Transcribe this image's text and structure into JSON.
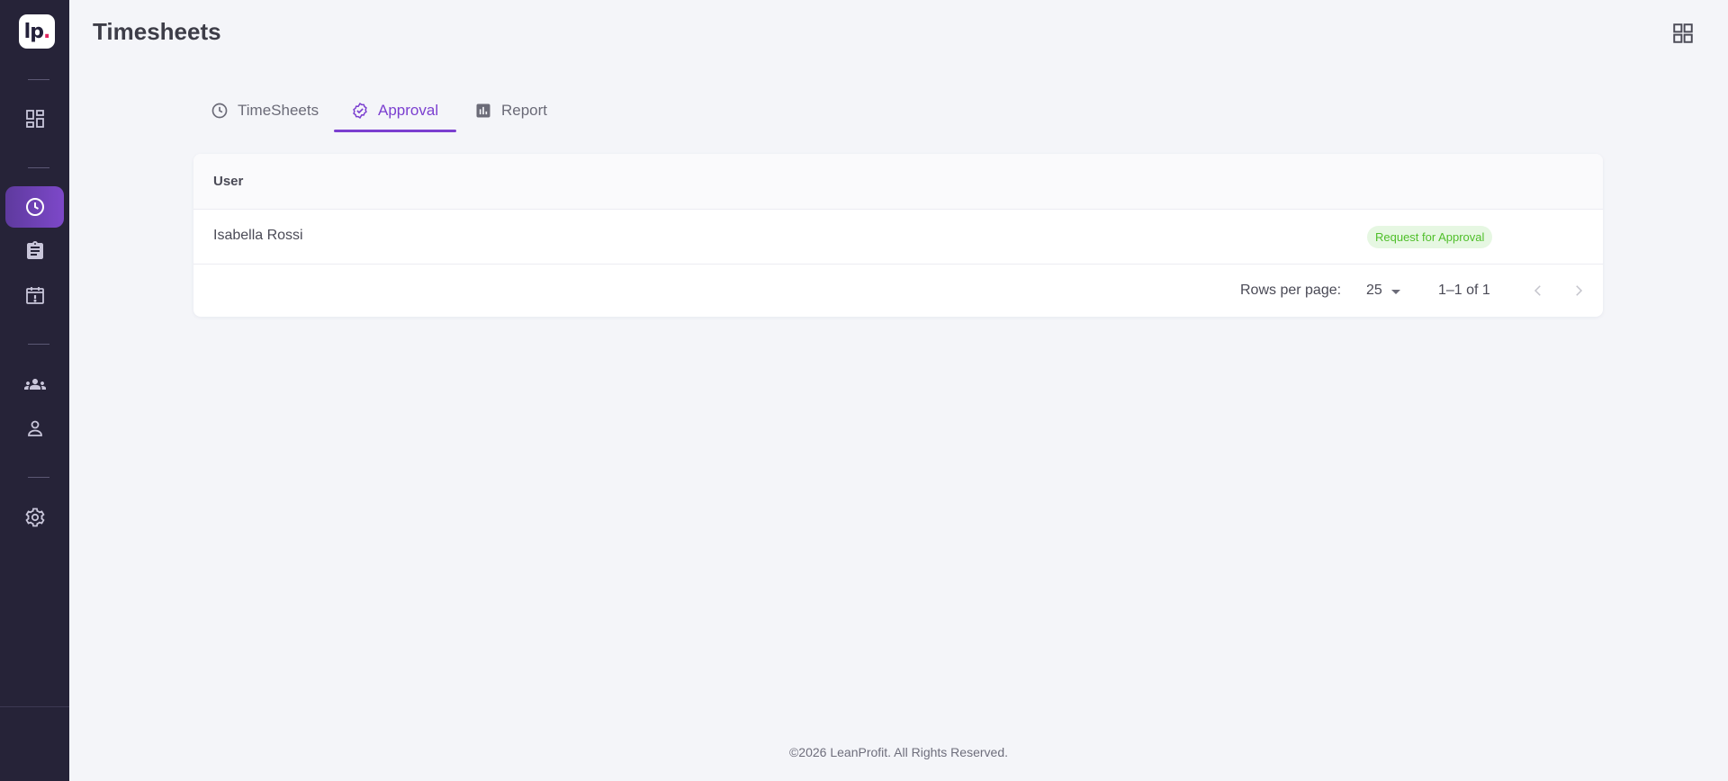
{
  "app": {
    "logo_text": "lp",
    "logo_dot": ".",
    "page_title": "Timesheets"
  },
  "colors": {
    "sidebar_bg": "#262338",
    "accent": "#7b3fd0",
    "status_green": "#4fbf2a",
    "status_green_bg": "#e6f7e2"
  },
  "sidebar": {
    "items": [
      {
        "icon": "dashboard-icon",
        "active": false
      },
      {
        "icon": "clock-icon",
        "active": true
      },
      {
        "icon": "clipboard-icon",
        "active": false
      },
      {
        "icon": "calendar-alert-icon",
        "active": false
      },
      {
        "icon": "group-icon",
        "active": false
      },
      {
        "icon": "person-icon",
        "active": false
      },
      {
        "icon": "gear-icon",
        "active": false
      }
    ]
  },
  "header": {
    "apps_icon": "apps-grid-icon"
  },
  "tabs": [
    {
      "label": "TimeSheets",
      "icon": "clock-icon",
      "active": false
    },
    {
      "label": "Approval",
      "icon": "verified-badge-icon",
      "active": true
    },
    {
      "label": "Report",
      "icon": "bar-chart-icon",
      "active": false
    }
  ],
  "table": {
    "columns": [
      "User"
    ],
    "rows": [
      {
        "user": "Isabella Rossi",
        "status": "Request for Approval"
      }
    ]
  },
  "pagination": {
    "rows_per_page_label": "Rows per page:",
    "rows_per_page_value": "25",
    "range_text": "1–1 of 1"
  },
  "footer": {
    "text": "©2026 LeanProfit. All Rights Reserved."
  }
}
